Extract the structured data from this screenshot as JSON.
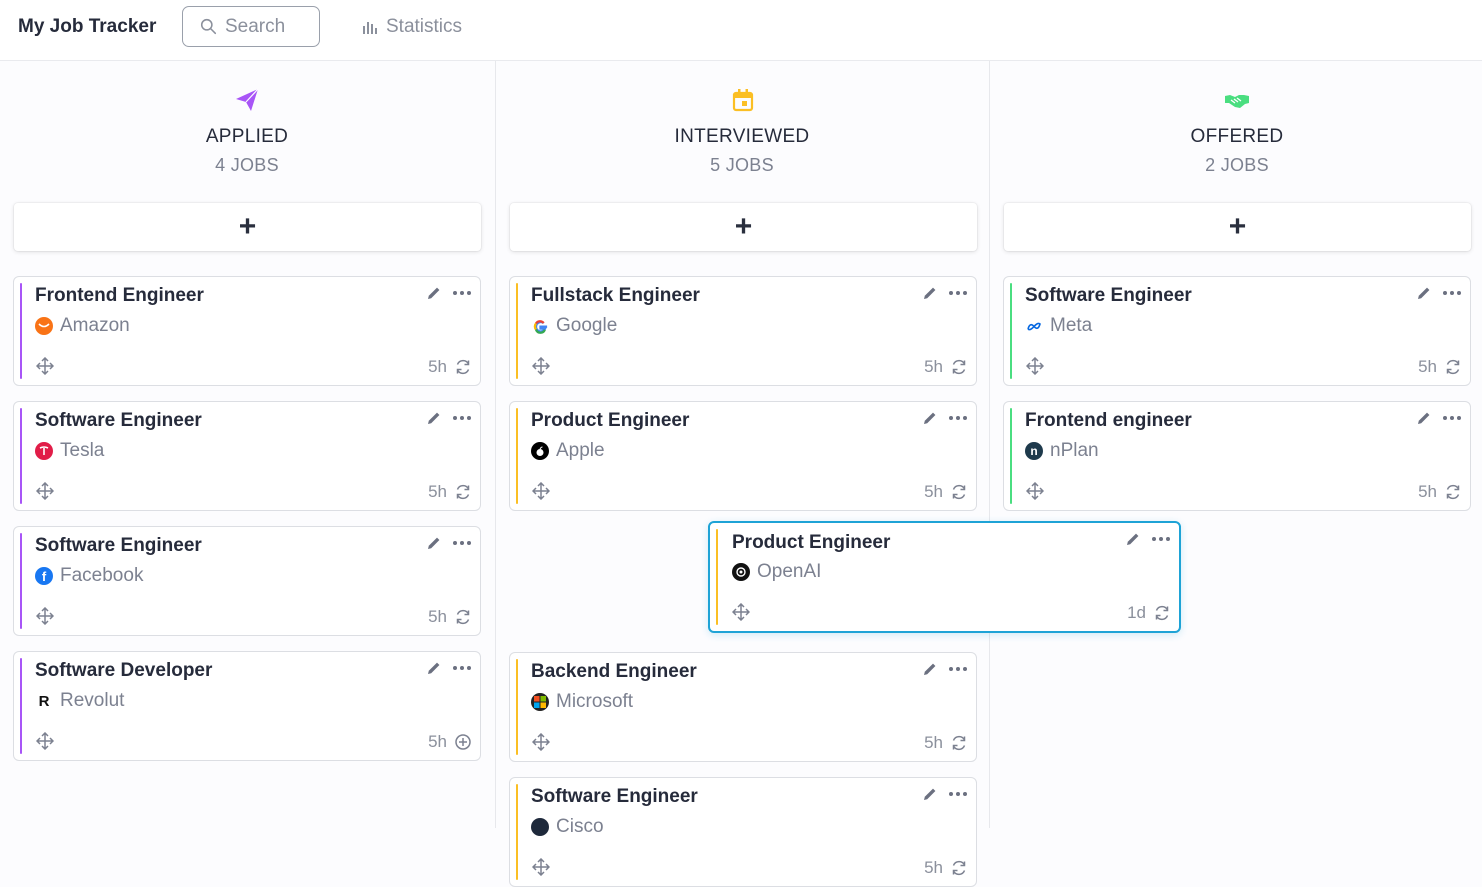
{
  "app": {
    "title": "My Job Tracker"
  },
  "search": {
    "placeholder": "Search"
  },
  "nav": {
    "statistics": "Statistics"
  },
  "add_label": "+",
  "columns": [
    {
      "title": "APPLIED",
      "count": "4 JOBS",
      "icon": "paper-plane-icon",
      "color": "#a855f7",
      "cards": [
        {
          "title": "Frontend Engineer",
          "company": "Amazon",
          "time": "5h",
          "status_icon": "refresh-icon"
        },
        {
          "title": "Software Engineer",
          "company": "Tesla",
          "time": "5h",
          "status_icon": "refresh-icon"
        },
        {
          "title": "Software Engineer",
          "company": "Facebook",
          "time": "5h",
          "status_icon": "refresh-icon"
        },
        {
          "title": "Software Developer",
          "company": "Revolut",
          "time": "5h",
          "status_icon": "plus-circle-icon"
        }
      ]
    },
    {
      "title": "INTERVIEWED",
      "count": "5 JOBS",
      "icon": "calendar-icon",
      "color": "#fbbf24",
      "cards": [
        {
          "title": "Fullstack Engineer",
          "company": "Google",
          "time": "5h",
          "status_icon": "refresh-icon"
        },
        {
          "title": "Product Engineer",
          "company": "Apple",
          "time": "5h",
          "status_icon": "refresh-icon"
        },
        {
          "title": "Backend Engineer",
          "company": "Microsoft",
          "time": "5h",
          "status_icon": "refresh-icon"
        },
        {
          "title": "Software Engineer",
          "company": "Cisco",
          "time": "5h",
          "status_icon": "refresh-icon"
        }
      ]
    },
    {
      "title": "OFFERED",
      "count": "2 JOBS",
      "icon": "handshake-icon",
      "color": "#4ade80",
      "cards": [
        {
          "title": "Software Engineer",
          "company": "Meta",
          "time": "5h",
          "status_icon": "refresh-icon"
        },
        {
          "title": "Frontend engineer",
          "company": "nPlan",
          "time": "5h",
          "status_icon": "refresh-icon"
        }
      ]
    }
  ],
  "dragging_card": {
    "title": "Product Engineer",
    "company": "OpenAI",
    "time": "1d",
    "status_icon": "refresh-icon",
    "color": "#fbbf24"
  }
}
